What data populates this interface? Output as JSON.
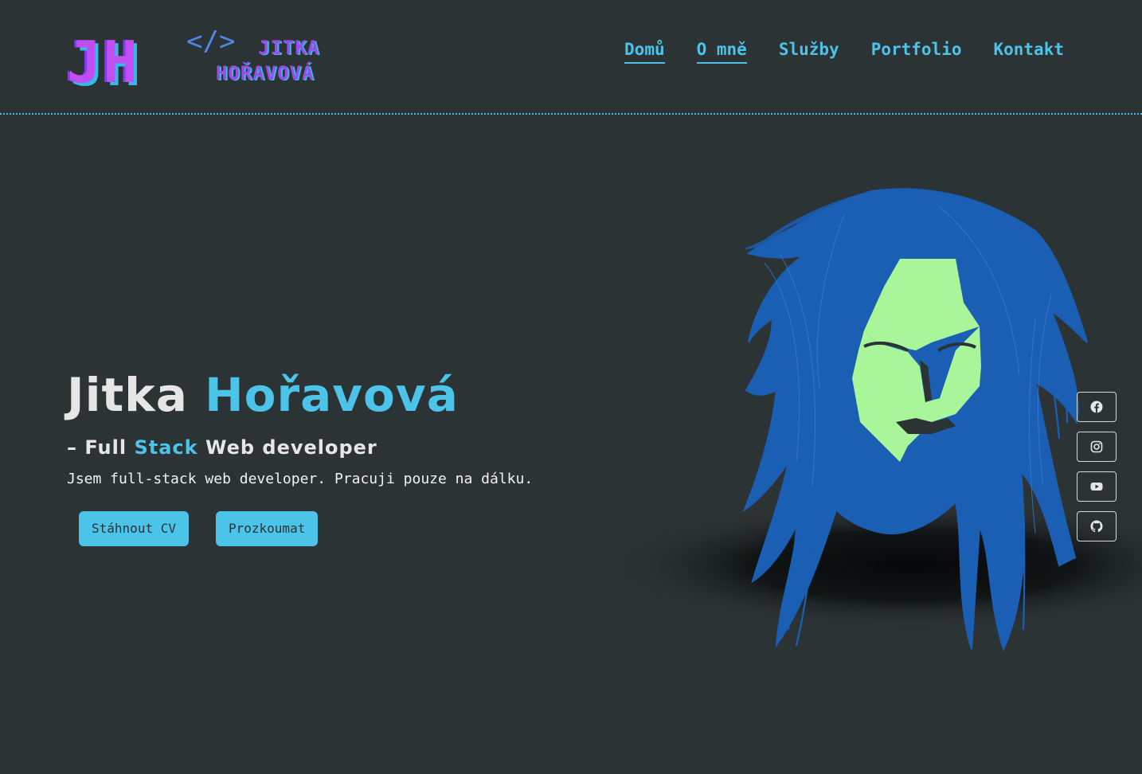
{
  "colors": {
    "background": "#2c3335",
    "accent": "#4cc3e8",
    "text": "#e6e6e6",
    "face": "#a9f59a",
    "hair": "#1a5fb4",
    "logo_purple": "#c24df0"
  },
  "logo": {
    "initials": "JH",
    "code_symbol": "</>",
    "name_line1": "JITKA",
    "name_line2": "HOŘAVOVÁ"
  },
  "nav": {
    "items": [
      {
        "label": "Domů"
      },
      {
        "label": "O mně"
      },
      {
        "label": "Služby"
      },
      {
        "label": "Portfolio"
      },
      {
        "label": "Kontakt"
      }
    ]
  },
  "hero": {
    "first_name": "Jitka",
    "last_name": "Hořavová",
    "sub_prefix": "– Full",
    "sub_accent": "Stack",
    "sub_suffix": "Web developer",
    "description": "Jsem full-stack web developer. Pracuji pouze na dálku.",
    "button_cv": "Stáhnout CV",
    "button_explore": "Prozkoumat"
  },
  "social": [
    {
      "icon": "facebook-icon"
    },
    {
      "icon": "instagram-icon"
    },
    {
      "icon": "youtube-icon"
    },
    {
      "icon": "github-icon"
    }
  ]
}
